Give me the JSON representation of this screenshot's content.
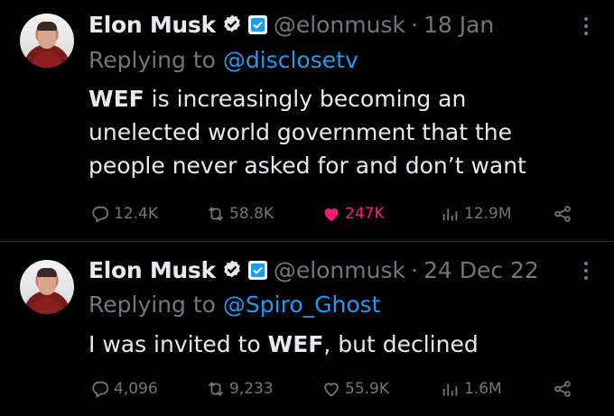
{
  "tweets": [
    {
      "author": "Elon Musk",
      "handle": "@elonmusk",
      "separator": "·",
      "date": "18 Jan",
      "replying_prefix": "Replying to",
      "replying_to": "@disclosetv",
      "body_bold": "WEF",
      "body_line1_rest": " is increasingly becoming an",
      "body_line2": "unelected world government that the",
      "body_line3": "people never asked for and don’t want",
      "replies": "12.4K",
      "reposts": "58.8K",
      "likes": "247K",
      "liked": true,
      "views": "12.9M"
    },
    {
      "author": "Elon Musk",
      "handle": "@elonmusk",
      "separator": "·",
      "date": "24 Dec 22",
      "replying_prefix": "Replying to",
      "replying_to": "@Spiro_Ghost",
      "body_pre": "I was invited to ",
      "body_bold": "WEF",
      "body_post": ", but declined",
      "replies": "4,096",
      "reposts": "9,233",
      "likes": "55.9K",
      "liked": false,
      "views": "1.6M"
    }
  ],
  "colors": {
    "background": "#000000",
    "text": "#e7e9ea",
    "muted": "#71767b",
    "link": "#1d9bf0",
    "like": "#f91880"
  },
  "icons": [
    "verified-badge-icon",
    "affiliate-x-icon",
    "more-icon",
    "reply-icon",
    "repost-icon",
    "like-icon",
    "views-icon",
    "share-icon"
  ]
}
